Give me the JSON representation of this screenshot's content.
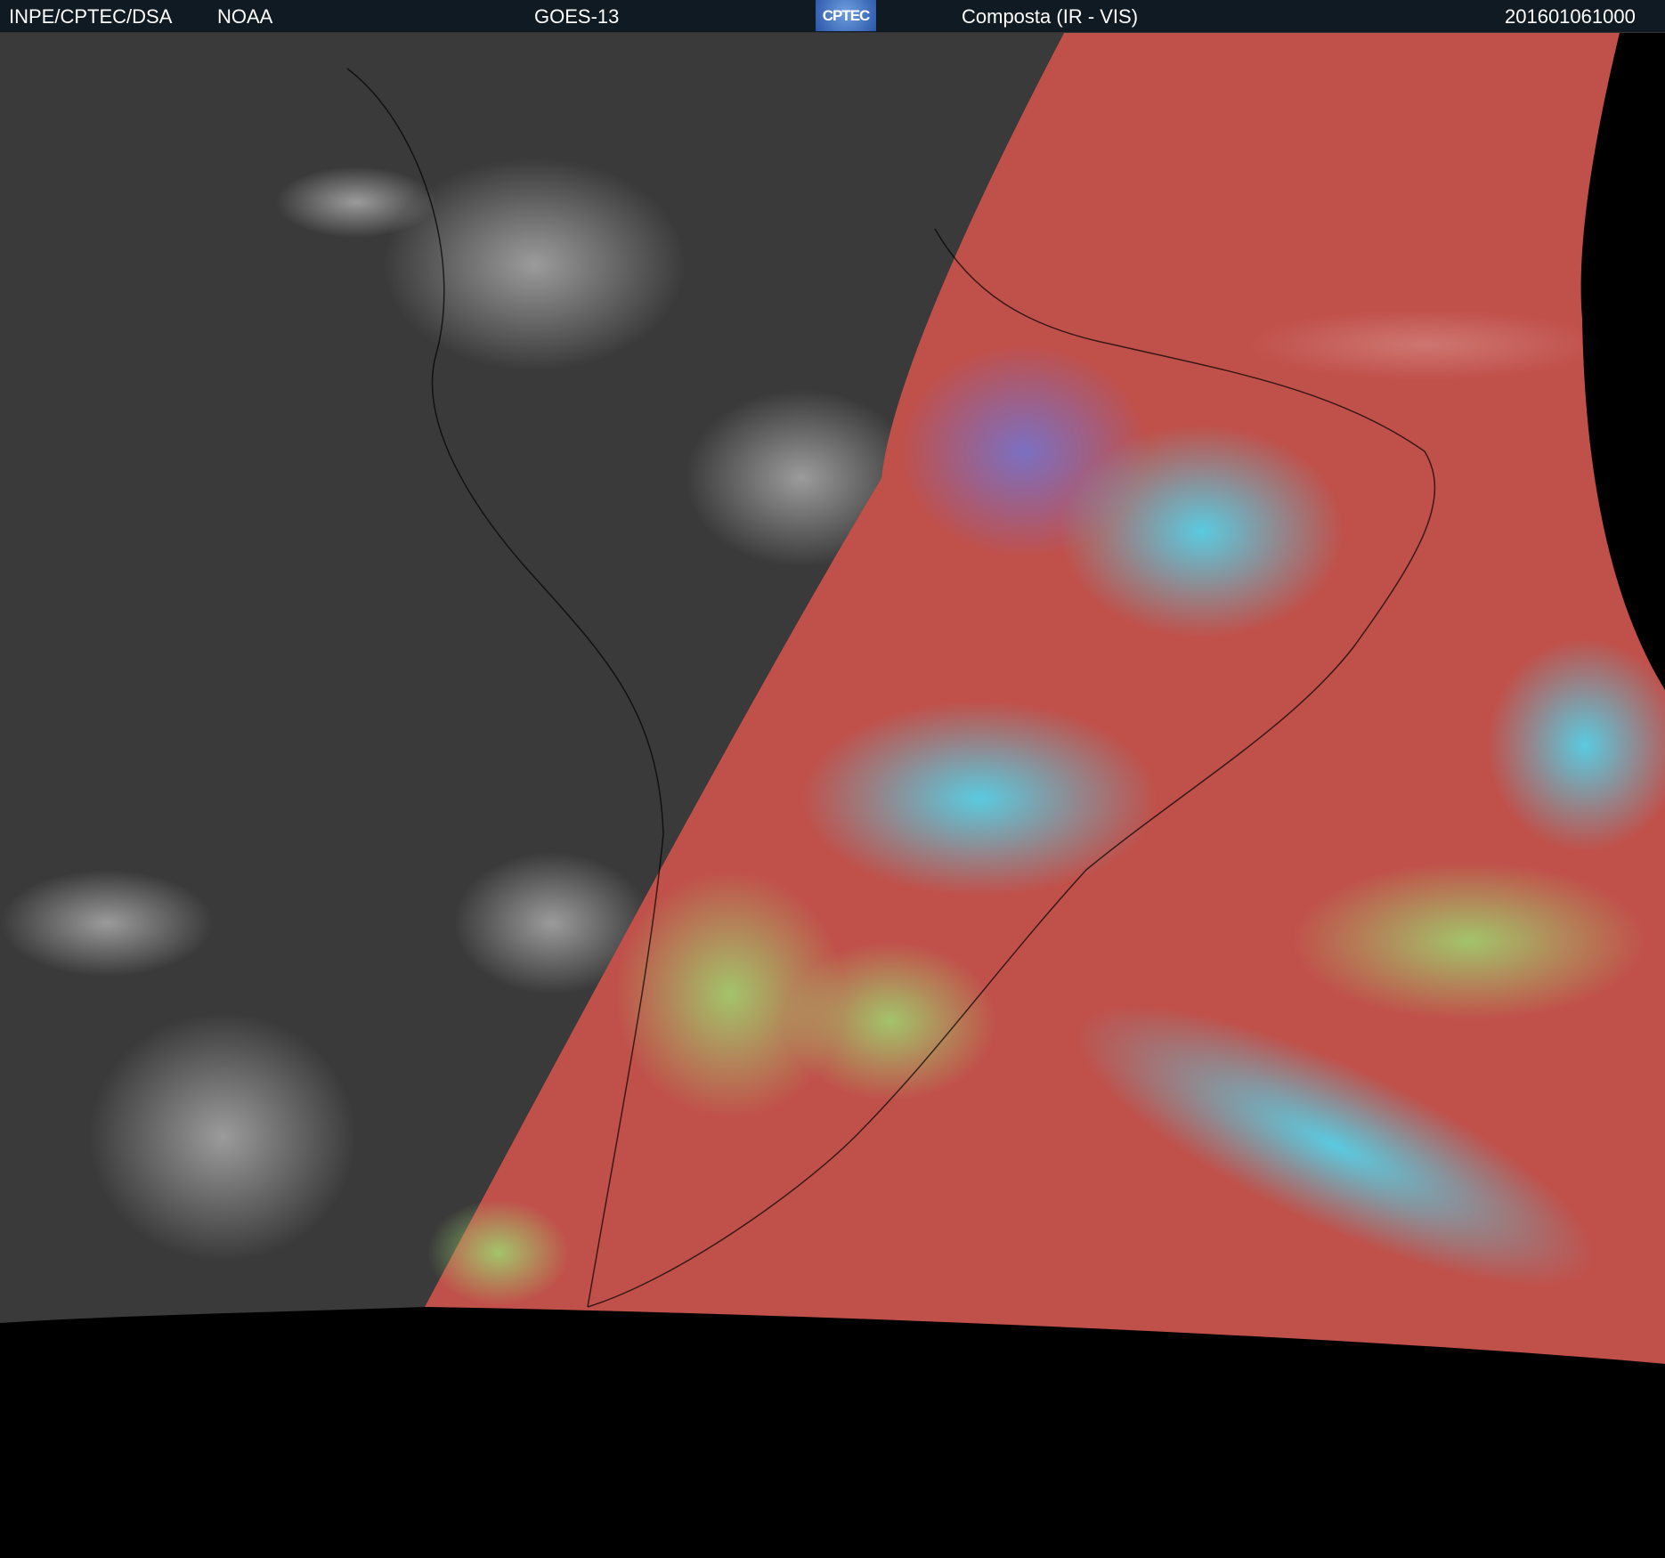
{
  "header": {
    "agency": "INPE/CPTEC/DSA",
    "source": "NOAA",
    "satellite": "GOES-13",
    "logo_text": "CPTEC",
    "product": "Composta (IR - VIS)",
    "timestamp": "201601061000"
  },
  "colors": {
    "header_bg": "#0f1a22",
    "night_side": "#3a3a3a",
    "day_side": "#c0504a",
    "cloud_cyan": "#4fd8f0",
    "cloud_green": "#9ed870"
  }
}
